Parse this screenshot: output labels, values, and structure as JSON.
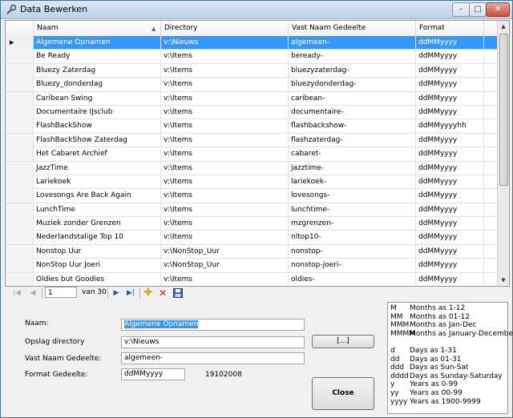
{
  "window": {
    "title": "Data Bewerken",
    "minimize": "–",
    "maximize": "□",
    "close": "✕"
  },
  "grid": {
    "columns": [
      "Naam",
      "Directory",
      "Vast Naam Gedeelte",
      "Format"
    ],
    "sort_column": "Naam",
    "selected_row": 0,
    "rows": [
      [
        "Algemene Opnamen",
        "v:\\Nieuws",
        "algemeen-",
        "ddMMyyyy"
      ],
      [
        "Be Ready",
        "v:\\Items",
        "beready-",
        "ddMMyyyy"
      ],
      [
        "Bluezy Zaterdag",
        "v:\\Items",
        "bluezyzaterdag-",
        "ddMMyyyy"
      ],
      [
        "Bluezy_donderdag",
        "v:\\Items",
        "bluezydonderdag-",
        "ddMMyyyy"
      ],
      [
        "Caribean Swing",
        "v:\\Items",
        "caribean-",
        "ddMMyyyy"
      ],
      [
        "Documentaire IJsclub",
        "v:\\Items",
        "documentaire-",
        "ddMMyyyy"
      ],
      [
        "FlashBackShow",
        "v:\\Items",
        "flashbackshow-",
        "ddMMyyyyhh"
      ],
      [
        "FlashBackShow Zaterdag",
        "v:\\Items",
        "flashzaterdag-",
        "ddMMyyyy"
      ],
      [
        "Het Cabaret Archief",
        "v:\\Items",
        "cabaret-",
        "ddMMyyyy"
      ],
      [
        "JazzTime",
        "v:\\Items",
        "jazztime-",
        "ddMMyyyy"
      ],
      [
        "Lariekoek",
        "v:\\Items",
        "lariekoek-",
        "ddMMyyyy"
      ],
      [
        "Lovesongs Are Back Again",
        "v:\\Items",
        "lovesongs-",
        "ddMMyyyy"
      ],
      [
        "LunchTime",
        "v:\\Items",
        "lunchtime-",
        "ddMMyyyy"
      ],
      [
        "Muziek zonder Grenzen",
        "v:\\Items",
        "mzgrenzen-",
        "ddMMyyyy"
      ],
      [
        "Nederlandstalige Top 10",
        "v:\\Items",
        "nltop10-",
        "ddMMyyyy"
      ],
      [
        "Nonstop Uur",
        "v:\\NonStop_Uur",
        "nonstop-",
        "ddMMyyyy"
      ],
      [
        "NonStop Uur Joeri",
        "v:\\NonStop_Uur",
        "nonstop-joeri-",
        "ddMMyyyy"
      ],
      [
        "Oldies but Goodies",
        "v:\\Items",
        "oldies-",
        "ddMMyyyy"
      ]
    ]
  },
  "navigator": {
    "position": "1",
    "of_label": "van 30"
  },
  "form": {
    "naam_label": "Naam:",
    "naam_value": "Algemene Opnamen",
    "opslag_label": "Opslag directory",
    "opslag_value": "v:\\Nieuws",
    "vast_label": "Vast Naam Gedeelte:",
    "vast_value": "algemeen-",
    "format_label": "Format Gedeelte:",
    "format_value": "ddMMyyyy",
    "format_preview": "19102008",
    "browse_label": "[...]",
    "close_label": "Close"
  },
  "help": {
    "lines": [
      {
        "code": "M",
        "text": "Months as 1-12"
      },
      {
        "code": "MM",
        "text": "Months as 01-12"
      },
      {
        "code": "MMM",
        "text": "Months as Jan-Dec"
      },
      {
        "code": "MMMM",
        "text": "Months as January-December"
      },
      {
        "code": "",
        "text": ""
      },
      {
        "code": "d",
        "text": "Days as 1-31"
      },
      {
        "code": "dd",
        "text": "Days as 01-31"
      },
      {
        "code": "ddd",
        "text": "Days as Sun-Sat"
      },
      {
        "code": "dddd",
        "text": "Days as Sunday-Saturday"
      },
      {
        "code": "y",
        "text": "Years as 0-99"
      },
      {
        "code": "yy",
        "text": "Years as 00-99"
      },
      {
        "code": "yyyy",
        "text": "Years as 1900-9999"
      }
    ]
  },
  "colors": {
    "selection": "#3399ff",
    "accent_add": "#e8a000",
    "accent_delete": "#d22020",
    "nav_arrow": "#1f5fb0"
  }
}
